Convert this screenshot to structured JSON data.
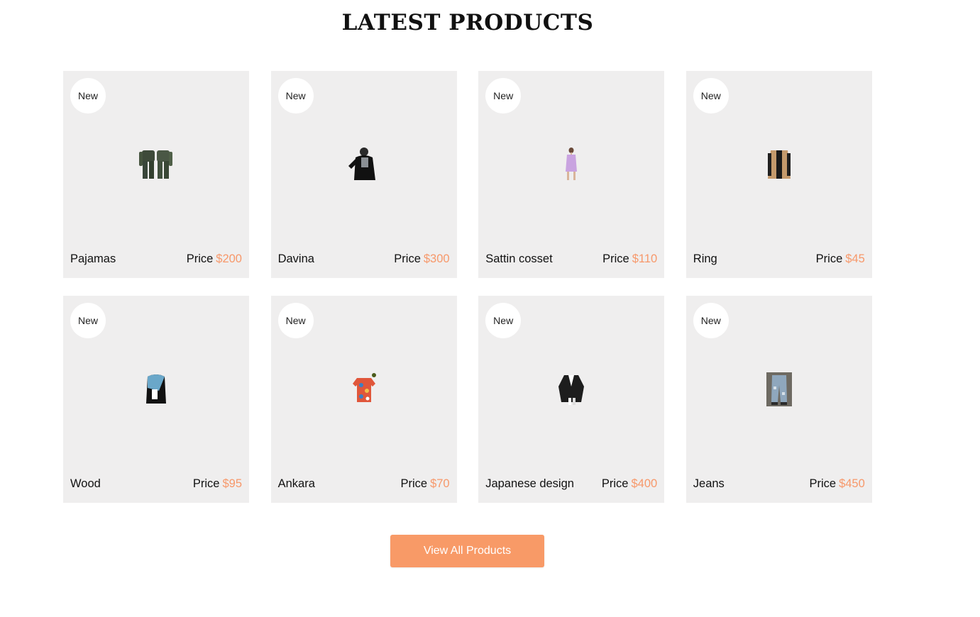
{
  "section": {
    "title": "LATEST PRODUCTS"
  },
  "products": [
    {
      "badge": "New",
      "name": "Pajamas",
      "price_label": "Price",
      "price": "$200",
      "image_icon": "pajamas-image"
    },
    {
      "badge": "New",
      "name": "Davina",
      "price_label": "Price",
      "price": "$300",
      "image_icon": "davina-image"
    },
    {
      "badge": "New",
      "name": "Sattin cosset",
      "price_label": "Price",
      "price": "$110",
      "image_icon": "sattin-cosset-image"
    },
    {
      "badge": "New",
      "name": "Ring",
      "price_label": "Price",
      "price": "$45",
      "image_icon": "ring-image"
    },
    {
      "badge": "New",
      "name": "Wood",
      "price_label": "Price",
      "price": "$95",
      "image_icon": "wood-image"
    },
    {
      "badge": "New",
      "name": "Ankara",
      "price_label": "Price",
      "price": "$70",
      "image_icon": "ankara-image"
    },
    {
      "badge": "New",
      "name": "Japanese design",
      "price_label": "Price",
      "price": "$400",
      "image_icon": "japanese-design-image"
    },
    {
      "badge": "New",
      "name": "Jeans",
      "price_label": "Price",
      "price": "$450",
      "image_icon": "jeans-image"
    }
  ],
  "actions": {
    "view_all_label": "View All Products"
  },
  "colors": {
    "accent": "#f89a67",
    "price": "#f7986a",
    "card_background": "#efeeee",
    "badge_background": "#ffffff"
  }
}
